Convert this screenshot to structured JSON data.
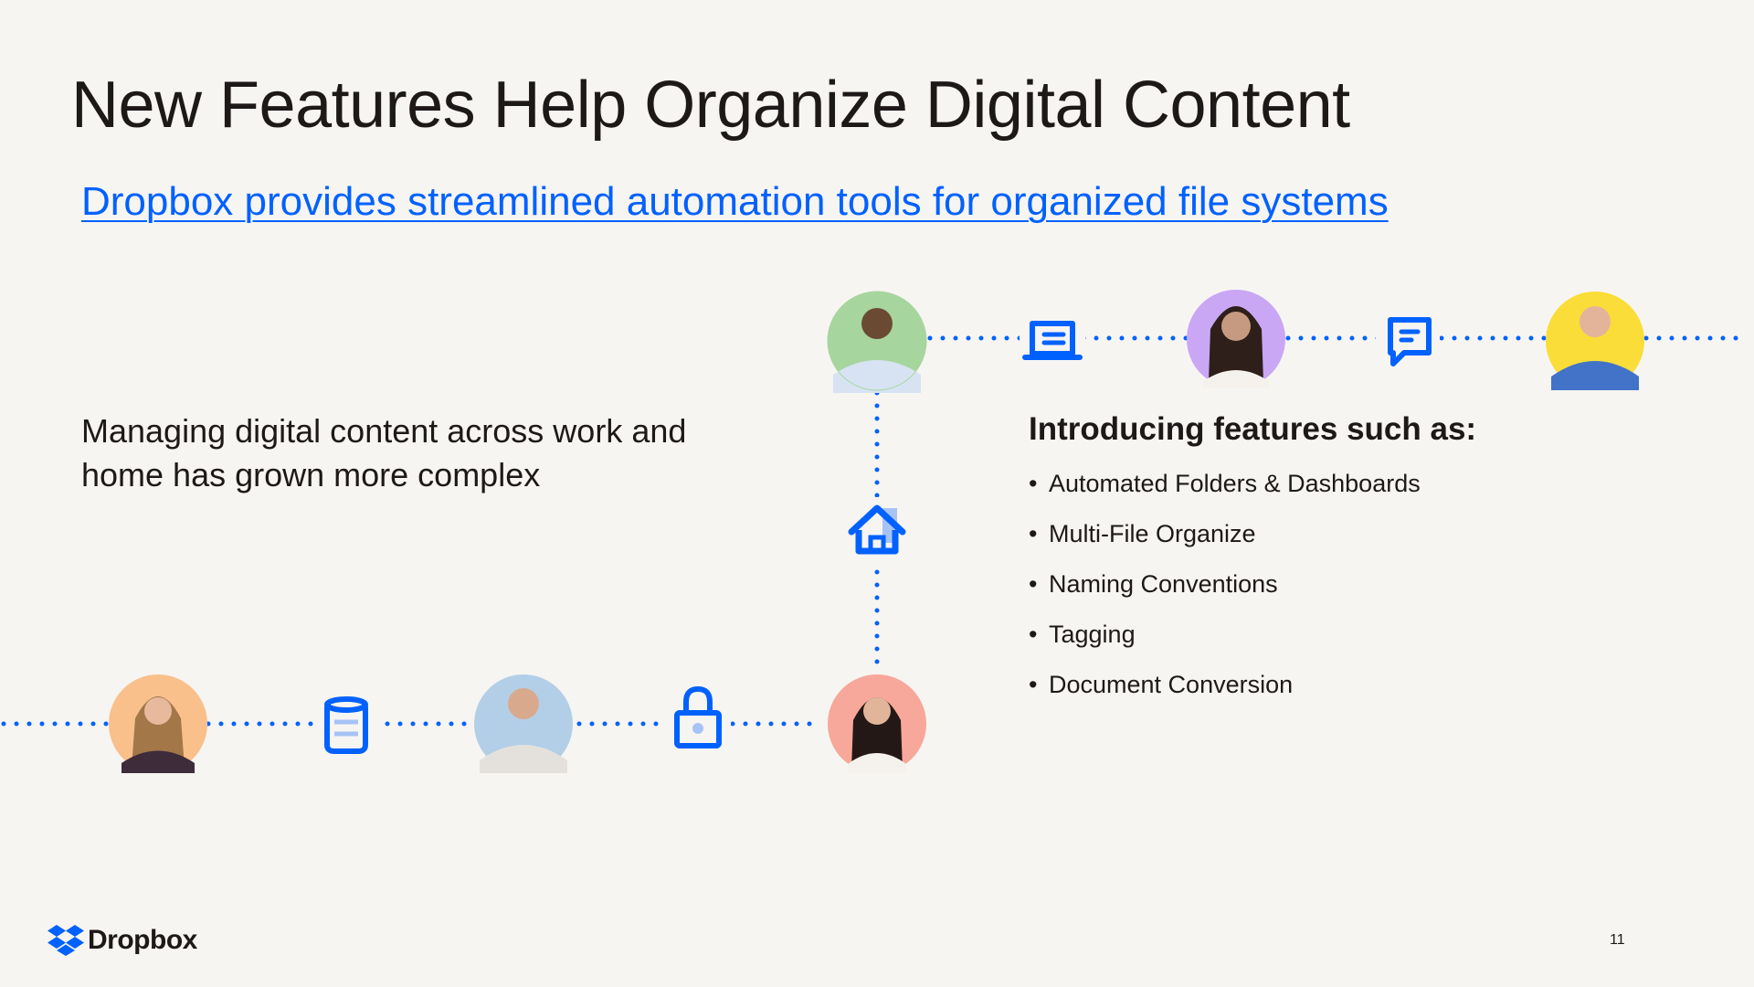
{
  "slide": {
    "title": "New Features Help Organize Digital Content",
    "subtitle": "Dropbox provides streamlined automation tools for organized file systems",
    "left_text": "Managing digital content across work and home has grown more complex",
    "features_heading": "Introducing features such as:",
    "features": [
      "Automated Folders & Dashboards",
      "Multi-File Organize",
      "Naming Conventions",
      "Tagging",
      "Document Conversion"
    ],
    "bullet": "•",
    "brand": "Dropbox",
    "page_number": "11"
  },
  "colors": {
    "accent": "#0061fe",
    "avatar_green": "#a7d59e",
    "avatar_purple": "#c9a7f5",
    "avatar_yellow": "#fadd38",
    "avatar_peach": "#f9c08b",
    "avatar_blue": "#b3cfe8",
    "avatar_coral": "#f7a89a"
  },
  "icons": [
    "presentation-icon",
    "chat-icon",
    "home-icon",
    "file-stack-icon",
    "lock-icon",
    "dropbox-logo-icon"
  ]
}
